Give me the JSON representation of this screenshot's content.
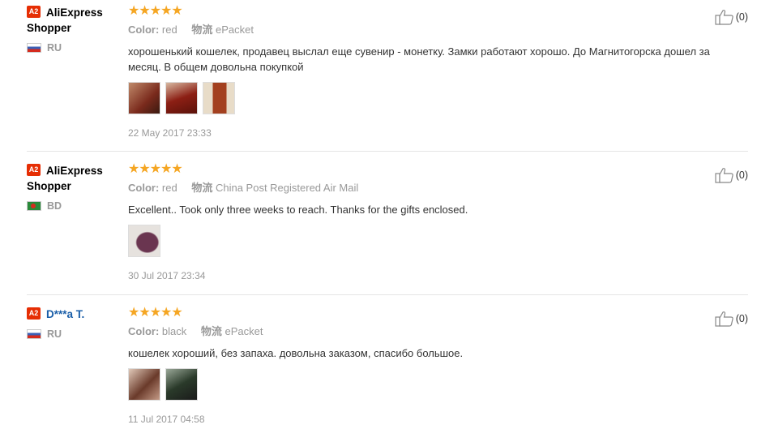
{
  "reviews": [
    {
      "badge": "A2",
      "name": "AliExpress Shopper",
      "country": "RU",
      "flag": "russia-flag",
      "stars": "★★★★★",
      "rating": 5,
      "color_label": "Color:",
      "color_value": "red",
      "shipping_label": "物流",
      "shipping_value": "ePacket",
      "text": "хорошенький кошелек, продавец выслал еще сувенир - монетку. Замки работают хорошо. До Магнитогорска дошел за месяц. В общем довольна покупкой",
      "photos": [
        "#7a2a1c",
        "#8c1f14",
        "#a3401f"
      ],
      "date": "22 May 2017 23:33",
      "helpful": "(0)"
    },
    {
      "badge": "A2",
      "name": "AliExpress Shopper",
      "country": "BD",
      "flag": "bangladesh-flag",
      "stars": "★★★★★",
      "rating": 5,
      "color_label": "Color:",
      "color_value": "red",
      "shipping_label": "物流",
      "shipping_value": "China Post Registered Air Mail",
      "text": "Excellent.. Took only three weeks to reach. Thanks for the gifts enclosed.",
      "photos": [
        "#5a2a3a"
      ],
      "date": "30 Jul 2017 23:34",
      "helpful": "(0)"
    },
    {
      "badge": "A2",
      "name": "D***a T.",
      "country": "RU",
      "flag": "russia-flag",
      "stars": "★★★★★",
      "rating": 5,
      "color_label": "Color:",
      "color_value": "black",
      "shipping_label": "物流",
      "shipping_value": "ePacket",
      "text": "кошелек хороший, без запаха. довольна заказом, спасибо большое.",
      "photos": [
        "#6a3a2a",
        "#2a3a2a"
      ],
      "date": "11 Jul 2017 04:58",
      "helpful": "(0)"
    }
  ]
}
